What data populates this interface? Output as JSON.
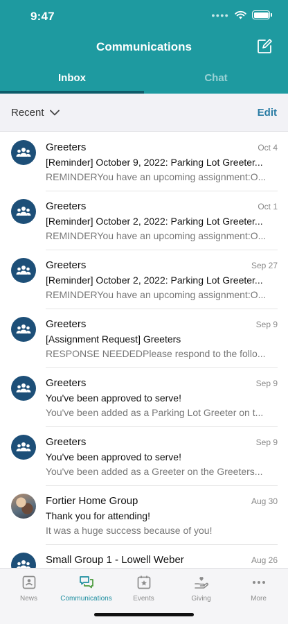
{
  "status_bar": {
    "time": "9:47"
  },
  "header": {
    "title": "Communications",
    "tabs": [
      {
        "label": "Inbox",
        "active": true
      },
      {
        "label": "Chat",
        "active": false
      }
    ],
    "compose_icon": "compose-icon"
  },
  "filter": {
    "label": "Recent",
    "edit_label": "Edit"
  },
  "messages": [
    {
      "sender": "Greeters",
      "date": "Oct 4",
      "subject": "[Reminder] October 9, 2022: Parking Lot Greeter...",
      "preview": "REMINDERYou have an upcoming assignment:O...",
      "avatar": "group-icon"
    },
    {
      "sender": "Greeters",
      "date": "Oct 1",
      "subject": "[Reminder] October 2, 2022: Parking Lot Greeter...",
      "preview": "REMINDERYou have an upcoming assignment:O...",
      "avatar": "group-icon"
    },
    {
      "sender": "Greeters",
      "date": "Sep 27",
      "subject": "[Reminder] October 2, 2022: Parking Lot Greeter...",
      "preview": "REMINDERYou have an upcoming assignment:O...",
      "avatar": "group-icon"
    },
    {
      "sender": "Greeters",
      "date": "Sep 9",
      "subject": "[Assignment Request] Greeters",
      "preview": "RESPONSE NEEDEDPlease respond to the follo...",
      "avatar": "group-icon"
    },
    {
      "sender": "Greeters",
      "date": "Sep 9",
      "subject": "You've been approved to serve!",
      "preview": "You've been added as a Parking Lot Greeter on t...",
      "avatar": "group-icon"
    },
    {
      "sender": "Greeters",
      "date": "Sep 9",
      "subject": "You've been approved to serve!",
      "preview": "You've been added as a Greeter on the Greeters...",
      "avatar": "group-icon"
    },
    {
      "sender": "Fortier Home Group",
      "date": "Aug 30",
      "subject": "Thank you for attending!",
      "preview": "It was a huge success because of you!",
      "avatar": "photo"
    },
    {
      "sender": "Small Group 1 - Lowell Weber",
      "date": "Aug 26",
      "subject": "",
      "preview": "",
      "avatar": "group-icon"
    }
  ],
  "tabbar": [
    {
      "label": "News",
      "icon": "news-icon",
      "active": false
    },
    {
      "label": "Communications",
      "icon": "chat-bubbles-icon",
      "active": true
    },
    {
      "label": "Events",
      "icon": "calendar-star-icon",
      "active": false
    },
    {
      "label": "Giving",
      "icon": "giving-hand-icon",
      "active": false
    },
    {
      "label": "More",
      "icon": "more-dots-icon",
      "active": false
    }
  ],
  "colors": {
    "header": "#1e9aa0",
    "tab_indicator": "#0e5c6a",
    "avatar": "#1d4f78",
    "accent": "#1e8ea0",
    "edit": "#2a7ca4"
  }
}
